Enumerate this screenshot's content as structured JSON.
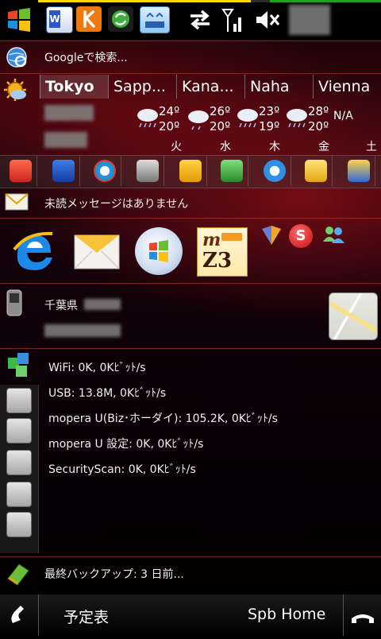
{
  "status": {
    "progress": 0.62
  },
  "search": {
    "placeholder": "Googleで検索..."
  },
  "weather": {
    "tabs": [
      "Tokyo",
      "Sapp...",
      "Kana...",
      "Naha",
      "Vienna"
    ],
    "forecast": [
      {
        "high": "24º",
        "low": "20º",
        "day": "火"
      },
      {
        "high": "26º",
        "low": "20º",
        "day": "水"
      },
      {
        "high": "23º",
        "low": "19º",
        "day": "木"
      },
      {
        "high": "28º",
        "low": "20º",
        "day": "金"
      },
      {
        "high": "N/A",
        "low": "",
        "day": "土"
      }
    ]
  },
  "messages": {
    "text": "未読メッセージはありません"
  },
  "contact": {
    "name": "千葉県"
  },
  "network": {
    "items": [
      "WiFi:  0K, 0Kﾋﾞｯﾄ/s",
      "USB:  13.8M, 0Kﾋﾞｯﾄ/s",
      "mopera U(Biz･ホーダイ):  105.2K, 0Kﾋﾞｯﾄ/s",
      "mopera U 設定:  0K, 0Kﾋﾞｯﾄ/s",
      "SecurityScan:  0K, 0Kﾋﾞｯﾄ/s"
    ]
  },
  "backup": {
    "text": "最終バックアップ: 3 日前..."
  },
  "softkeys": {
    "left": "予定表",
    "right": "Spb Home"
  },
  "colors": {
    "accent": "#b0101e",
    "progress_yellow": "#ffd800",
    "progress_green": "#1fa01f"
  }
}
